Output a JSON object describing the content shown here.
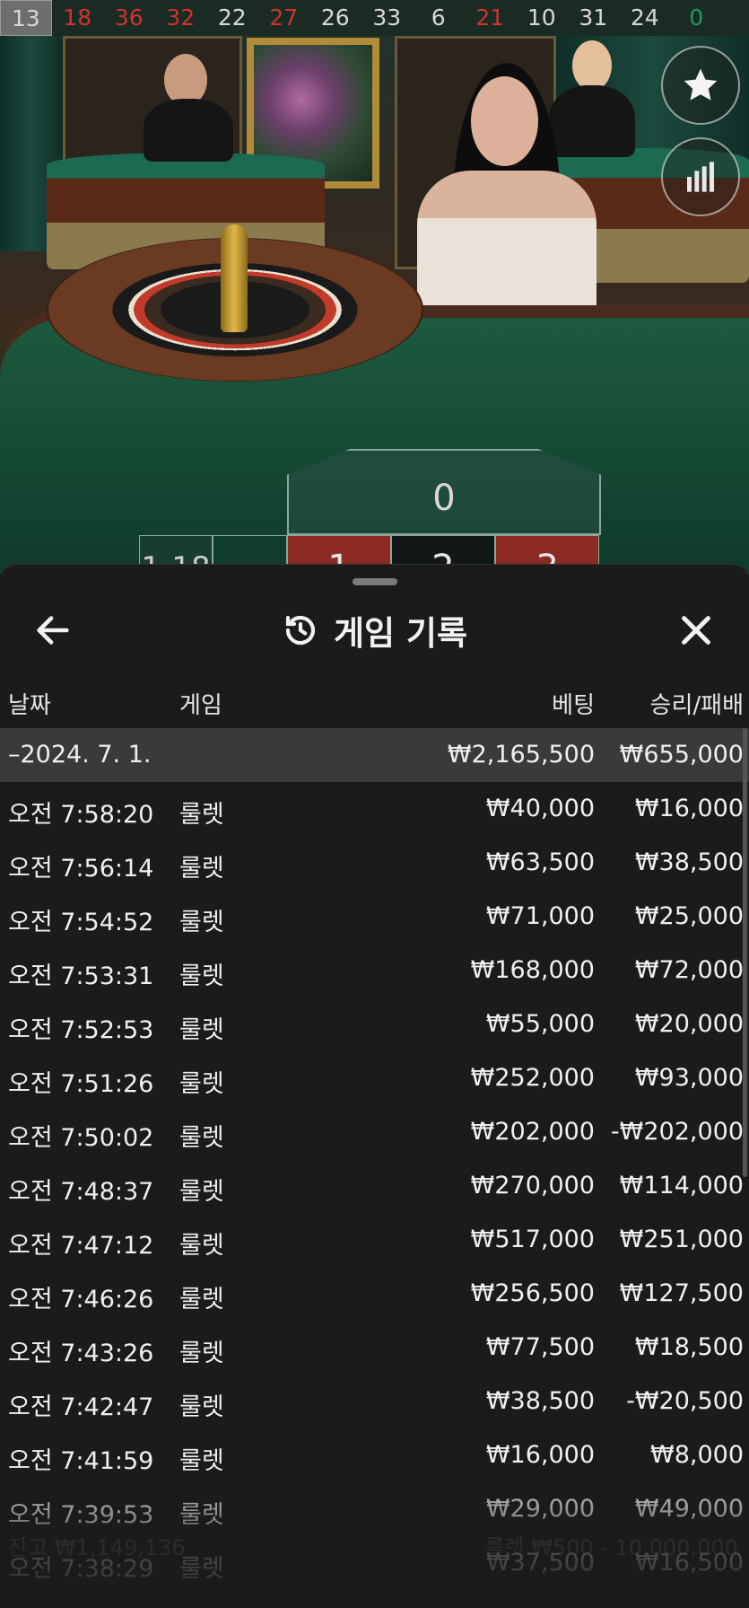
{
  "results_strip": [
    {
      "value": "13",
      "color": "black"
    },
    {
      "value": "18",
      "color": "red"
    },
    {
      "value": "36",
      "color": "red"
    },
    {
      "value": "32",
      "color": "red"
    },
    {
      "value": "22",
      "color": "black"
    },
    {
      "value": "27",
      "color": "red"
    },
    {
      "value": "26",
      "color": "black"
    },
    {
      "value": "33",
      "color": "black"
    },
    {
      "value": "6",
      "color": "black"
    },
    {
      "value": "21",
      "color": "red"
    },
    {
      "value": "10",
      "color": "black"
    },
    {
      "value": "31",
      "color": "black"
    },
    {
      "value": "24",
      "color": "black"
    },
    {
      "value": "0",
      "color": "green"
    }
  ],
  "table": {
    "zero": "0",
    "cells": [
      {
        "label": "1",
        "color": "red"
      },
      {
        "label": "2",
        "color": "black"
      },
      {
        "label": "3",
        "color": "red"
      }
    ],
    "side_label": "1-18"
  },
  "icons": {
    "favorite": "star-icon",
    "stats": "bar-chart-icon",
    "back": "arrow-left-icon",
    "history": "history-icon",
    "close": "close-icon"
  },
  "sheet": {
    "title": "게임 기록",
    "columns": {
      "date": "날짜",
      "game": "게임",
      "bet": "베팅",
      "win": "승리/패배"
    },
    "summary": {
      "date": "–2024. 7. 1.",
      "bet": "₩2,165,500",
      "win": "₩655,000"
    },
    "rows": [
      {
        "time": "오전 7:58:20",
        "game": "룰렛",
        "bet": "₩40,000",
        "win": "₩16,000"
      },
      {
        "time": "오전 7:56:14",
        "game": "룰렛",
        "bet": "₩63,500",
        "win": "₩38,500"
      },
      {
        "time": "오전 7:54:52",
        "game": "룰렛",
        "bet": "₩71,000",
        "win": "₩25,000"
      },
      {
        "time": "오전 7:53:31",
        "game": "룰렛",
        "bet": "₩168,000",
        "win": "₩72,000"
      },
      {
        "time": "오전 7:52:53",
        "game": "룰렛",
        "bet": "₩55,000",
        "win": "₩20,000"
      },
      {
        "time": "오전 7:51:26",
        "game": "룰렛",
        "bet": "₩252,000",
        "win": "₩93,000"
      },
      {
        "time": "오전 7:50:02",
        "game": "룰렛",
        "bet": "₩202,000",
        "win": "-₩202,000"
      },
      {
        "time": "오전 7:48:37",
        "game": "룰렛",
        "bet": "₩270,000",
        "win": "₩114,000"
      },
      {
        "time": "오전 7:47:12",
        "game": "룰렛",
        "bet": "₩517,000",
        "win": "₩251,000"
      },
      {
        "time": "오전 7:46:26",
        "game": "룰렛",
        "bet": "₩256,500",
        "win": "₩127,500"
      },
      {
        "time": "오전 7:43:26",
        "game": "룰렛",
        "bet": "₩77,500",
        "win": "₩18,500"
      },
      {
        "time": "오전 7:42:47",
        "game": "룰렛",
        "bet": "₩38,500",
        "win": "-₩20,500"
      },
      {
        "time": "오전 7:41:59",
        "game": "룰렛",
        "bet": "₩16,000",
        "win": "₩8,000"
      },
      {
        "time": "오전 7:39:53",
        "game": "룰렛",
        "bet": "₩29,000",
        "win": "₩49,000"
      },
      {
        "time": "오전 7:38:29",
        "game": "룰렛",
        "bet": "₩37,500",
        "win": "₩16,500"
      }
    ]
  },
  "footer_ghost": {
    "balance": "잔고 ₩1,149,136",
    "limits": "룰렛 ₩500 - 10,000,000"
  }
}
